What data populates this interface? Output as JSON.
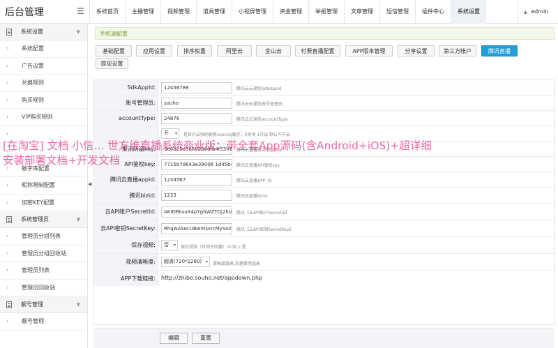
{
  "header": {
    "title": "后台管理",
    "nav": [
      "系统首页",
      "主播管理",
      "视频管理",
      "道具管理",
      "小视屏管理",
      "资金管理",
      "举报管理",
      "文章管理",
      "短信管理",
      "插件中心",
      "系统设置"
    ],
    "active_index": 10,
    "user": "admin"
  },
  "sidebar": {
    "groups": [
      {
        "label": "系统设置",
        "items": [
          "系统配置",
          "广告设置",
          "兑换规则",
          "购买规则",
          "VIP购买规则",
          "",
          "",
          "敏字库配置",
          "昵称限制配置",
          "加密KEY配置"
        ]
      },
      {
        "label": "系统管理员",
        "items": [
          "管理员分组列表",
          "管理员分组回收站",
          "管理员列表",
          "管理员回收站"
        ]
      },
      {
        "label": "靓号管理",
        "items": [
          "靓号管理"
        ]
      }
    ]
  },
  "notice": "手机端配置",
  "tabs": [
    "基础配置",
    "应用设置",
    "排序权重",
    "阿里云",
    "金山云",
    "付费直播配置",
    "APP版本管理",
    "分享设置",
    "第三方帐户",
    "腾讯直播",
    "提现设置"
  ],
  "active_tab": 9,
  "form": {
    "sdkappid": {
      "label": "SdkAppId:",
      "value": "12456789",
      "hint": "腾讯云云通信SdkAppId"
    },
    "admin": {
      "label": "账号管理员:",
      "value": "souho",
      "hint": "腾讯云云通信账号管理员"
    },
    "account_type": {
      "label": "accountType:",
      "value": "24876",
      "hint": "腾讯云云通信accountType"
    },
    "row4": {
      "select": "开",
      "hint": "是否开启强制更新usersig缓存，0关闭 1开启 默认不开启"
    },
    "push_key": {
      "label": "推流防盗key:",
      "value": "3e6325e5680238dfb4f53ff62c",
      "hint": "腾讯云直播推流防盗key"
    },
    "api_key": {
      "label": "API鉴权key:",
      "value": "7715b78643e39006 1d45b4d8",
      "hint": "腾讯云直播API鉴权key"
    },
    "live_appid": {
      "label": "腾讯云直播appid:",
      "value": "1234567",
      "hint": "腾讯云直播APP_ID"
    },
    "bizid": {
      "label": "腾讯bizid:",
      "value": "1233",
      "hint": "腾讯云直播bizid"
    },
    "secret_id": {
      "label": "云API帐户SecretId:",
      "value": "AKIDRksoX4pYghWZTOj2hVI",
      "hint": "腾讯【云API帐户SecretId】"
    },
    "secret_key": {
      "label": "云API密钥SecretKey:",
      "value": "RhqwASecUBwmsxrcMySozi",
      "hint": "腾讯【云API密钥SecretKey】"
    },
    "save_video": {
      "label": "保存视频:",
      "value": "否",
      "hint": "保存视频（可用于回播）;0:否;1:是"
    },
    "clarity": {
      "label": "视频清晰度:",
      "value": "超清(720*1280)",
      "hint": "清晰度越高,流量费用越高"
    },
    "app_link": {
      "label": "APP下载链接:",
      "value": "http://zhibo.souho.net/appdown.php"
    }
  },
  "buttons": {
    "edit": "编辑",
    "reset": "重置"
  },
  "watermark": {
    "line1": "[在淘宝] 文档 小信... 世方维直播系统商业版：带全套App源码(含Android+iOS)+超详细",
    "line2": "安装部署文档+开发文档"
  }
}
